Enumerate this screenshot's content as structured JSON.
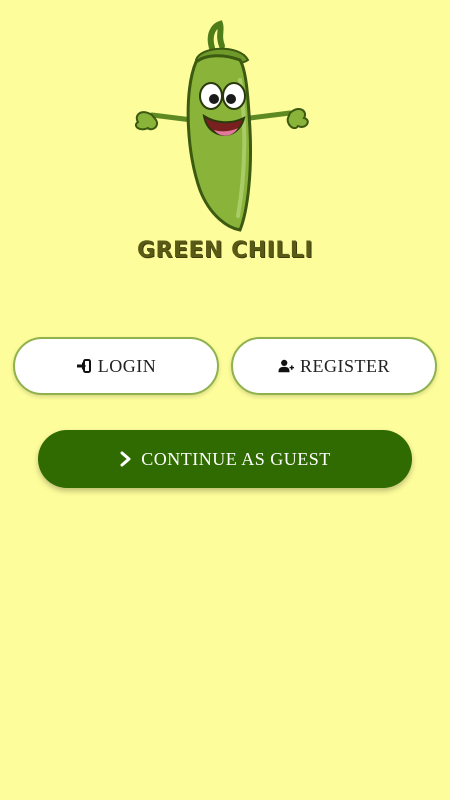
{
  "logo": {
    "icon": "green-chilli-mascot",
    "brand_text": "GREEN CHILLI"
  },
  "actions": {
    "login_label": "LOGIN",
    "login_icon": "sign-in-icon",
    "register_label": "REGISTER",
    "register_icon": "user-plus-icon",
    "guest_label": "CONTINUE AS GUEST",
    "guest_icon": "chevron-right-icon"
  },
  "colors": {
    "background": "#fdfd9b",
    "primary": "#2f6b00",
    "pill_border": "#8fb24c",
    "chilli_green": "#8ab33a"
  }
}
